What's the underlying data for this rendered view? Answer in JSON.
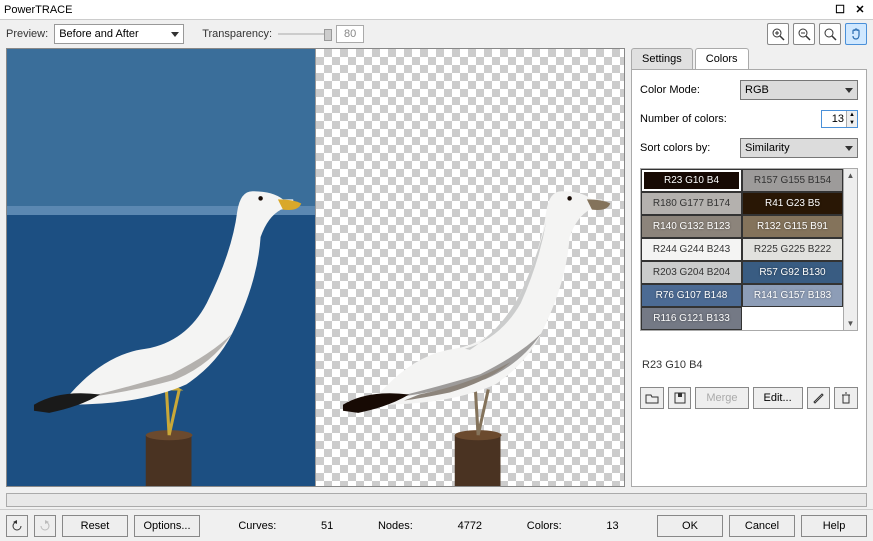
{
  "window": {
    "title": "PowerTRACE"
  },
  "toolbar": {
    "preview_label": "Preview:",
    "preview_value": "Before and After",
    "transparency_label": "Transparency:",
    "transparency_value": "80"
  },
  "tabs": {
    "settings": "Settings",
    "colors": "Colors"
  },
  "panel": {
    "color_mode_label": "Color Mode:",
    "color_mode_value": "RGB",
    "num_colors_label": "Number of colors:",
    "num_colors_value": "13",
    "sort_label": "Sort colors by:",
    "sort_value": "Similarity",
    "swatches": [
      {
        "label": "R23 G10 B4",
        "rgb": "#170a04",
        "selected": true
      },
      {
        "label": "R157 G155 B154",
        "rgb": "#9d9b9a"
      },
      {
        "label": "R180 G177 B174",
        "rgb": "#b4b1ae"
      },
      {
        "label": "R41 G23 B5",
        "rgb": "#291705"
      },
      {
        "label": "R140 G132 B123",
        "rgb": "#8c847b"
      },
      {
        "label": "R132 G115 B91",
        "rgb": "#84735b"
      },
      {
        "label": "R244 G244 B243",
        "rgb": "#f4f4f3"
      },
      {
        "label": "R225 G225 B222",
        "rgb": "#e1e1de"
      },
      {
        "label": "R203 G204 B204",
        "rgb": "#cbcccc"
      },
      {
        "label": "R57 G92 B130",
        "rgb": "#395c82"
      },
      {
        "label": "R76 G107 B148",
        "rgb": "#4c6b94"
      },
      {
        "label": "R141 G157 B183",
        "rgb": "#8d9db7"
      },
      {
        "label": "R116 G121 B133",
        "rgb": "#747985"
      }
    ],
    "selected_swatch_label": "R23 G10 B4",
    "merge_label": "Merge",
    "edit_label": "Edit..."
  },
  "footer": {
    "reset_label": "Reset",
    "options_label": "Options...",
    "curves_label": "Curves:",
    "curves_value": "51",
    "nodes_label": "Nodes:",
    "nodes_value": "4772",
    "colors_label": "Colors:",
    "colors_value": "13",
    "ok": "OK",
    "cancel": "Cancel",
    "help": "Help"
  }
}
